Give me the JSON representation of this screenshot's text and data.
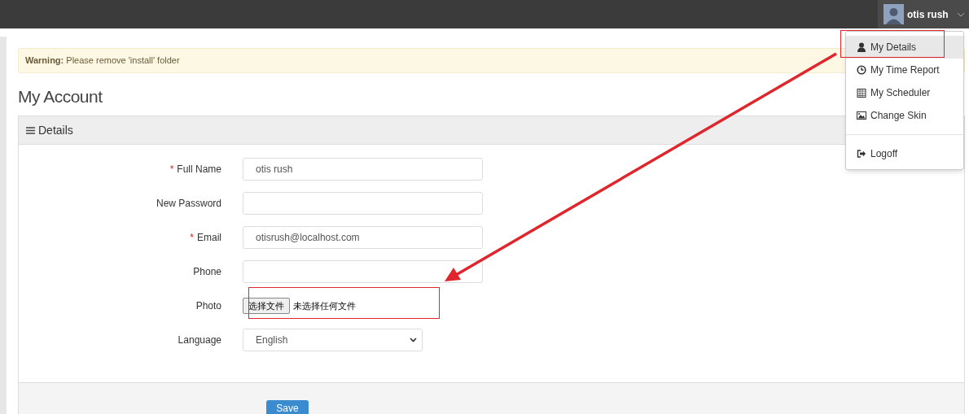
{
  "top_bar": {
    "user_name": "otis rush"
  },
  "user_menu": {
    "items": [
      {
        "kind": "user",
        "label": "My Details",
        "selected": true
      },
      {
        "kind": "clock",
        "label": "My Time Report",
        "selected": false
      },
      {
        "kind": "calendar",
        "label": "My Scheduler",
        "selected": false
      },
      {
        "kind": "image",
        "label": "Change Skin",
        "selected": false
      },
      {
        "kind": "divider"
      },
      {
        "kind": "logout",
        "label": "Logoff",
        "selected": false
      }
    ]
  },
  "warning": {
    "text": "**Warning:** Please remove 'install' folder"
  },
  "page_title": "My Account",
  "panel": {
    "title": "Details",
    "fields": [
      {
        "kind": "text",
        "label": "Full Name",
        "required_mark": "*",
        "value": "otis rush"
      },
      {
        "kind": "password",
        "label": "New Password"
      },
      {
        "kind": "text",
        "label": "Email",
        "required_mark": "*",
        "value": "otisrush@localhost.com"
      },
      {
        "kind": "text",
        "label": "Phone"
      },
      {
        "kind": "file",
        "label": "Photo",
        "button": "选择文件",
        "status": "未选择任何文件"
      },
      {
        "kind": "select",
        "label": "Language",
        "value": "English"
      }
    ],
    "save_button": "Save"
  },
  "annotations": [
    {
      "kind": "menu-box"
    },
    {
      "kind": "photo-box"
    },
    {
      "kind": "arrow"
    }
  ]
}
